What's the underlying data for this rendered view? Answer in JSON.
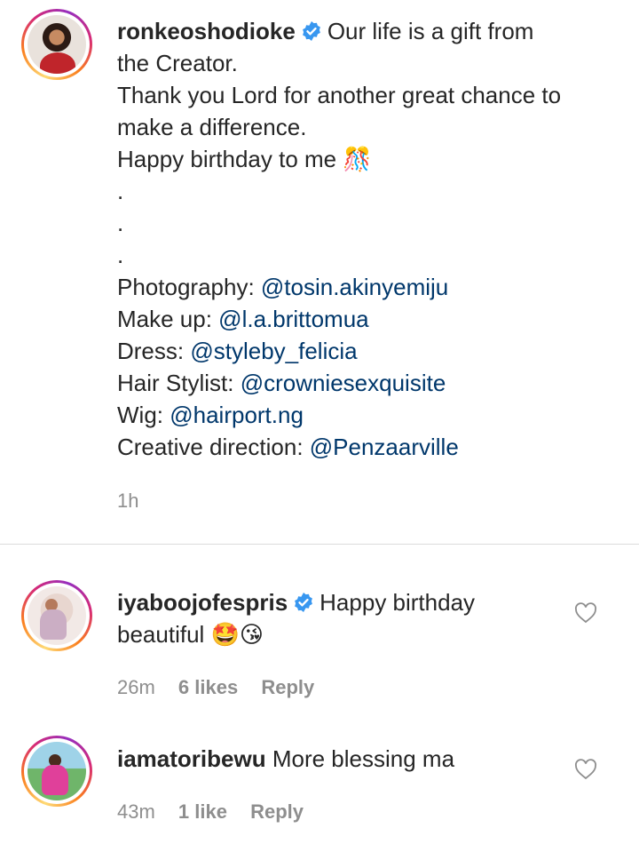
{
  "post": {
    "username": "ronkeoshodioke",
    "lines": [
      "Our life is a gift from",
      "the Creator.",
      "Thank you Lord for another great chance to",
      "make a difference.",
      "Happy birthday to me 🎊",
      ".",
      ".",
      "."
    ],
    "credits": [
      {
        "label": "Photography: ",
        "handle": "@tosin.akinyemiju"
      },
      {
        "label": "Make up: ",
        "handle": "@l.a.brittomua"
      },
      {
        "label": "Dress: ",
        "handle": "@styleby_felicia"
      },
      {
        "label": "Hair Stylist: ",
        "handle": "@crowniesexquisite"
      },
      {
        "label": "Wig: ",
        "handle": "@hairport.ng"
      },
      {
        "label": "Creative direction: ",
        "handle": "@Penzaarville"
      }
    ],
    "time": "1h"
  },
  "comments": [
    {
      "username": "iyaboojofespris",
      "verified": true,
      "text_line1": "Happy birthday",
      "text_line2": "beautiful 🤩😘",
      "time": "26m",
      "likes": "6 likes",
      "reply": "Reply"
    },
    {
      "username": "iamatoribewu",
      "verified": false,
      "text_line1": "More blessing ma",
      "time": "43m",
      "likes": "1 like",
      "reply": "Reply"
    }
  ],
  "colors": {
    "mention": "#00376b",
    "verified": "#3897f0",
    "meta": "#8e8e8e",
    "divider": "#dbdbdb"
  },
  "icons": [
    "verified-badge-icon",
    "heart-icon"
  ]
}
